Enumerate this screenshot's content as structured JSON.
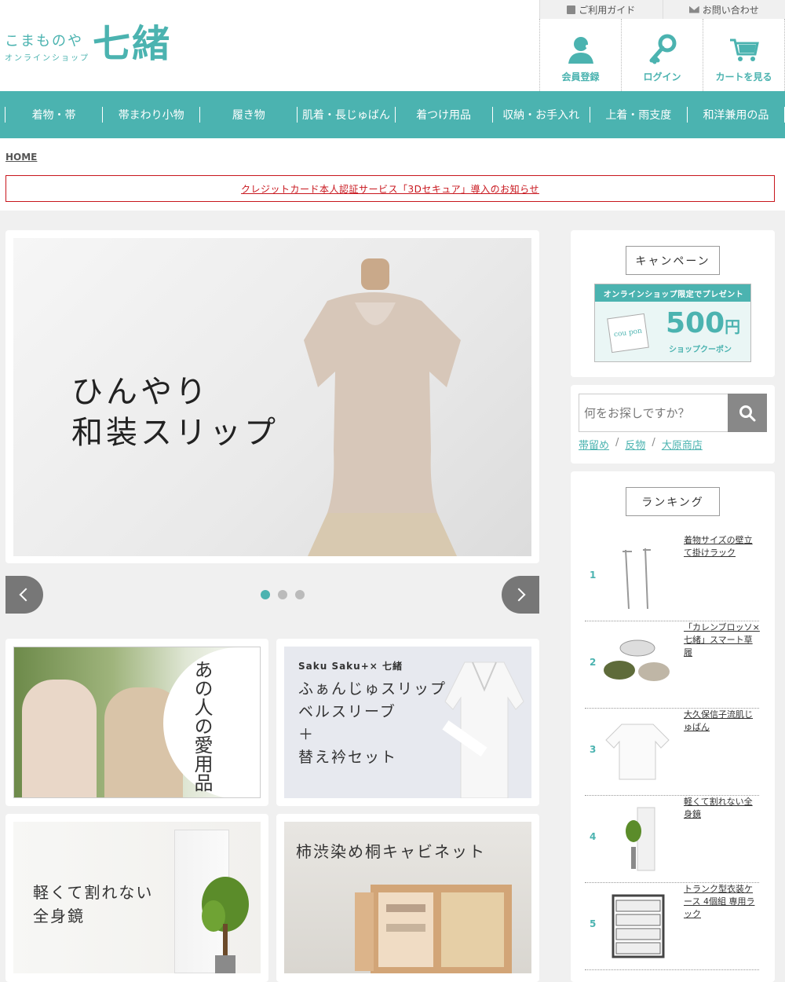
{
  "header": {
    "logo": {
      "sub1": "こまものや",
      "sub2": "オンラインショップ",
      "main": "七緒"
    },
    "top_links": [
      {
        "label": "ご利用ガイド",
        "icon": "book-icon"
      },
      {
        "label": "お問い合わせ",
        "icon": "mail-icon"
      }
    ],
    "icon_links": [
      {
        "label": "会員登録",
        "icon": "member-icon"
      },
      {
        "label": "ログイン",
        "icon": "key-icon"
      },
      {
        "label": "カートを見る",
        "icon": "cart-icon"
      }
    ]
  },
  "nav": {
    "items": [
      "着物・帯",
      "帯まわり小物",
      "履き物",
      "肌着・長じゅばん",
      "着つけ用品",
      "収納・お手入れ",
      "上着・雨支度",
      "和洋兼用の品"
    ]
  },
  "breadcrumb": "HOME",
  "notice": "クレジットカード本人認証サービス「3Dセキュア」導入のお知らせ",
  "hero": {
    "line1": "ひんやり",
    "line2": "和装スリップ",
    "slides": 3,
    "active_slide": 1
  },
  "banners": {
    "b1": {
      "text": "あの人の愛用品"
    },
    "b2": {
      "top": "Saku Saku+× 七緒",
      "line1": "ふぁんじゅスリップ",
      "line2": "ベルスリーブ",
      "line3": "＋",
      "line4": "替え衿セット"
    },
    "b3": {
      "line1": "軽くて割れない",
      "line2": "全身鏡"
    },
    "b4": {
      "text": "柿渋染め桐キャビネット"
    }
  },
  "sidebar": {
    "campaign_title": "キャンペーン",
    "coupon": {
      "top": "オンラインショップ限定でプレゼント",
      "ticket": "cou pon",
      "amount": "500",
      "yen": "円",
      "sub": "ショップクーポン"
    },
    "search": {
      "placeholder": "何をお探しですか？"
    },
    "tags": [
      "帯留め",
      "反物",
      "大原商店"
    ],
    "ranking_title": "ランキング",
    "ranking": [
      {
        "num": "1",
        "name": "着物サイズの壁立て掛けラック"
      },
      {
        "num": "2",
        "name": "「カレンブロッソ×七緒」スマート草履"
      },
      {
        "num": "3",
        "name": "大久保信子流肌じゅばん"
      },
      {
        "num": "4",
        "name": "軽くて割れない全身鏡"
      },
      {
        "num": "5",
        "name": "トランク型衣装ケース 4個組 専用ラック"
      }
    ]
  },
  "colors": {
    "accent": "#4bb3b0",
    "notice": "#c8161d"
  }
}
